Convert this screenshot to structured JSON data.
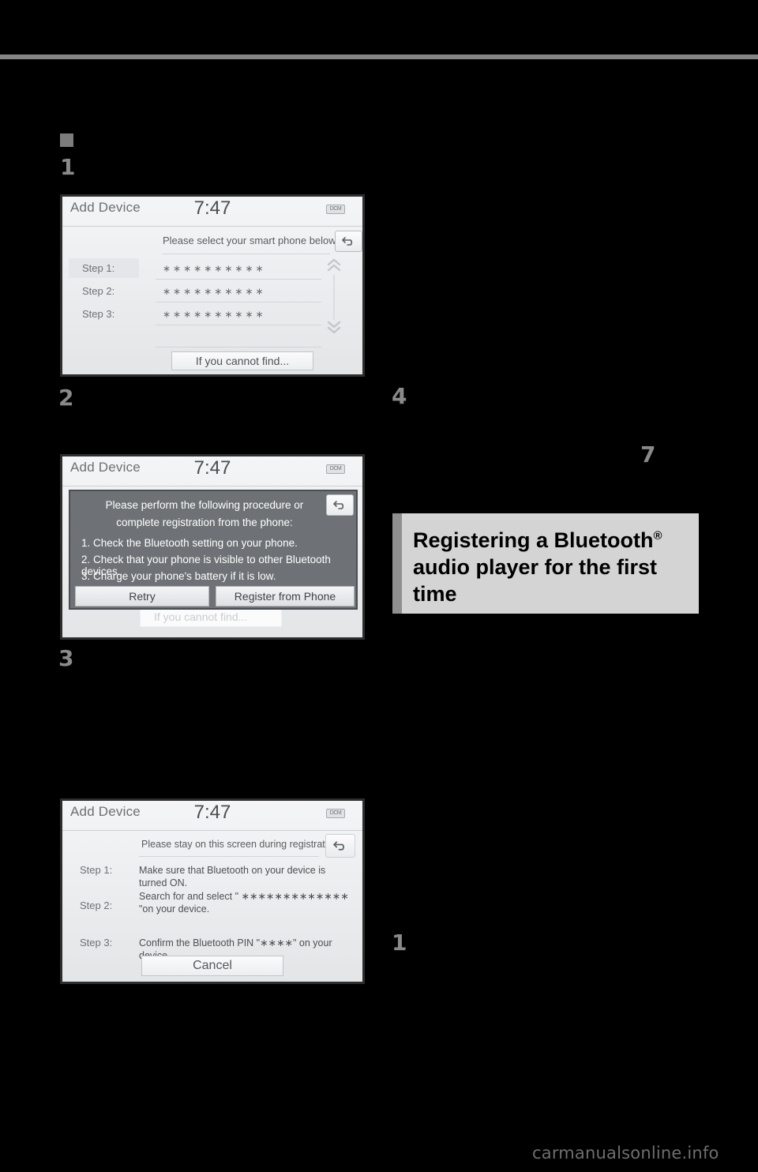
{
  "page": {
    "background_color": "#000000",
    "rule_color": "#858585",
    "numeral_color": "#8a8a8a",
    "watermark": "carmanualsonline.info"
  },
  "markers": {
    "square_bullet": "square-bullet",
    "left_column": [
      "1",
      "2",
      "3"
    ],
    "right_column": [
      "4",
      "7",
      "1"
    ]
  },
  "heading": {
    "line1": "Registering a Bluetooth",
    "registered_mark": "®",
    "line2": "audio player for the first",
    "line3": "time",
    "background_color": "#d4d4d4",
    "accent_color": "#8f8f8f"
  },
  "screenshots": [
    {
      "id": "add-device-select-phone",
      "title": "Add Device",
      "clock": "7:47",
      "status_badge": "DCM",
      "prompt": "Please select your smart phone below.",
      "back_button": "back-arrow",
      "scroll_up": "chevron-up-double",
      "scroll_down": "chevron-down-double",
      "rows": [
        {
          "label": "Step 1:",
          "value": "∗∗∗∗∗∗∗∗∗∗",
          "highlighted": true
        },
        {
          "label": "Step 2:",
          "value": "∗∗∗∗∗∗∗∗∗∗",
          "highlighted": false
        },
        {
          "label": "Step 3:",
          "value": "∗∗∗∗∗∗∗∗∗∗",
          "highlighted": false
        }
      ],
      "footer_button": "If you cannot find..."
    },
    {
      "id": "add-device-retry-dialog",
      "title": "Add Device",
      "clock": "7:47",
      "status_badge": "DCM",
      "back_button": "back-arrow",
      "dialog": {
        "heading_line1": "Please perform the following procedure or",
        "heading_line2": "complete registration from the phone:",
        "items": [
          "1. Check the Bluetooth setting on your phone.",
          "2. Check that your phone is visible to other Bluetooth devices.",
          "3. Charge your phone's battery if it is low."
        ],
        "buttons": [
          "Retry",
          "Register from Phone"
        ]
      },
      "background_button": "If you cannot find..."
    },
    {
      "id": "add-device-pairing-steps",
      "title": "Add Device",
      "clock": "7:47",
      "status_badge": "DCM",
      "prompt": "Please stay on this screen during registration...",
      "back_button": "back-arrow",
      "rows": [
        {
          "label": "Step 1:",
          "value": "Make sure that Bluetooth on your device is turned ON."
        },
        {
          "label": "Step 2:",
          "value": "Search for and select \" ∗∗∗∗∗∗∗∗∗∗∗∗∗ \"on your device."
        },
        {
          "label": "Step 3:",
          "value": "Confirm the Bluetooth PIN \"∗∗∗∗\" on your device."
        }
      ],
      "footer_button": "Cancel"
    }
  ]
}
